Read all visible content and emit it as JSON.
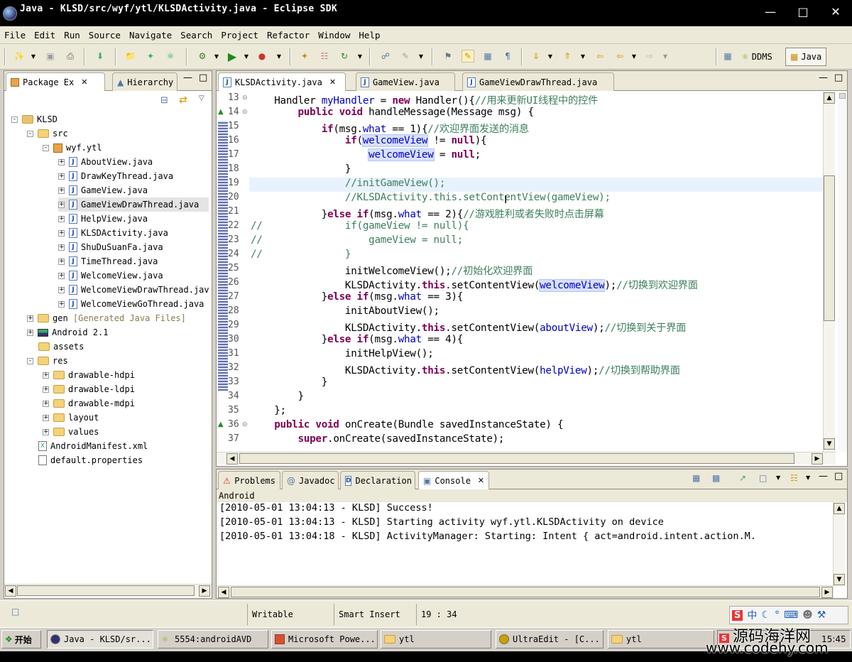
{
  "window": {
    "title": "Java - KLSD/src/wyf/ytl/KLSDActivity.java - Eclipse SDK"
  },
  "menu": [
    "File",
    "Edit",
    "Run",
    "Source",
    "Navigate",
    "Search",
    "Project",
    "Refactor",
    "Window",
    "Help"
  ],
  "perspectives": {
    "ddms": "DDMS",
    "java": "Java"
  },
  "left_tabs": {
    "package_explorer": "Package Ex",
    "hierarchy": "Hierarchy"
  },
  "tree": {
    "project": "KLSD",
    "src": "src",
    "package": "wyf.ytl",
    "files": [
      "AboutView.java",
      "DrawKeyThread.java",
      "GameView.java",
      "GameViewDrawThread.java",
      "HelpView.java",
      "KLSDActivity.java",
      "ShuDuSuanFa.java",
      "TimeThread.java",
      "WelcomeView.java",
      "WelcomeViewDrawThread.jav",
      "WelcomeViewGoThread.java"
    ],
    "gen": "gen",
    "gen_note": "[Generated Java Files]",
    "android": "Android 2.1",
    "assets": "assets",
    "res": "res",
    "res_folders": [
      "drawable-hdpi",
      "drawable-ldpi",
      "drawable-mdpi",
      "layout",
      "values"
    ],
    "manifest": "AndroidManifest.xml",
    "props": "default.properties"
  },
  "editor_tabs": [
    "KLSDActivity.java",
    "GameView.java",
    "GameViewDrawThread.java"
  ],
  "code": {
    "line_numbers": [
      "13",
      "14",
      "15",
      "16",
      "17",
      "18",
      "19",
      "20",
      "21",
      "22",
      "23",
      "24",
      "25",
      "26",
      "27",
      "28",
      "29",
      "30",
      "31",
      "32",
      "33",
      "34",
      "35",
      "36",
      "37"
    ],
    "l13": {
      "a": "    Handler ",
      "b": "myHandler",
      "c": " = ",
      "d": "new",
      "e": " Handler(){",
      "f": "//用来更新UI线程中的控件"
    },
    "l14": {
      "a": "        ",
      "b": "public void",
      "c": " handleMessage(Message msg) {"
    },
    "l15": {
      "a": "            ",
      "b": "if",
      "c": "(msg.",
      "d": "what",
      "e": " == 1){",
      "f": "//欢迎界面发送的消息"
    },
    "l16": {
      "a": "                ",
      "b": "if",
      "c": "(",
      "d": "welcomeView",
      "e": " != ",
      "f": "null",
      "g": "){"
    },
    "l17": {
      "a": "                    ",
      "b": "welcomeView",
      "c": " = ",
      "d": "null",
      "e": ";"
    },
    "l18": "                }",
    "l19": "                //initGameView();",
    "l20": "                //KLSDActivity.this.setContentView(gameView);",
    "l21": {
      "a": "            }",
      "b": "else if",
      "c": "(msg.",
      "d": "what",
      "e": " == 2){",
      "f": "//游戏胜利或者失败时点击屏幕"
    },
    "l22": "//              if(gameView != null){",
    "l23": "//                  gameView = null;",
    "l24": "//              }",
    "l25": {
      "a": "                initWelcomeView();",
      "b": "//初始化欢迎界面"
    },
    "l26": {
      "a": "                KLSDActivity.",
      "b": "this",
      "c": ".setContentView(",
      "d": "welcomeView",
      "e": ");",
      "f": "//切换到欢迎界面"
    },
    "l27": {
      "a": "            }",
      "b": "else if",
      "c": "(msg.",
      "d": "what",
      "e": " == 3){"
    },
    "l28": "                initAboutView();",
    "l29": {
      "a": "                KLSDActivity.",
      "b": "this",
      "c": ".setContentView(",
      "d": "aboutView",
      "e": ");",
      "f": "//切换到关于界面"
    },
    "l30": {
      "a": "            }",
      "b": "else if",
      "c": "(msg.",
      "d": "what",
      "e": " == 4){"
    },
    "l31": "                initHelpView();",
    "l32": {
      "a": "                KLSDActivity.",
      "b": "this",
      "c": ".setContentView(",
      "d": "helpView",
      "e": ");",
      "f": "//切换到帮助界面"
    },
    "l33": "            }",
    "l34": "        }",
    "l35": "    };",
    "l36": {
      "a": "    ",
      "b": "public void",
      "c": " onCreate(Bundle savedInstanceState) {"
    },
    "l37": {
      "a": "        ",
      "b": "super",
      "c": ".onCreate(savedInstanceState);"
    }
  },
  "bottom_tabs": [
    "Problems",
    "Javadoc",
    "Declaration",
    "Console"
  ],
  "console": {
    "label": "Android",
    "lines": [
      "[2010-05-01 13:04:13 - KLSD] Success!",
      "[2010-05-01 13:04:13 - KLSD] Starting activity wyf.ytl.KLSDActivity on device",
      "[2010-05-01 13:04:18 - KLSD] ActivityManager: Starting: Intent { act=android.intent.action.M."
    ]
  },
  "status": {
    "writable": "Writable",
    "insert": "Smart Insert",
    "position": "19 : 34"
  },
  "taskbar": {
    "start": "开始",
    "tasks": [
      "Java - KLSD/sr...",
      "5554:androidAVD",
      "Microsoft Powe...",
      "ytl",
      "UltraEdit - [C...",
      "ytl"
    ],
    "time": "15:45"
  },
  "ime": {
    "mode": "中"
  },
  "watermark": {
    "line1": "源码海洋网",
    "line2": "www.codehy.com"
  },
  "colors": {
    "keyword": "#7f0055",
    "comment": "#3f7f5f",
    "field": "#0000c0"
  }
}
